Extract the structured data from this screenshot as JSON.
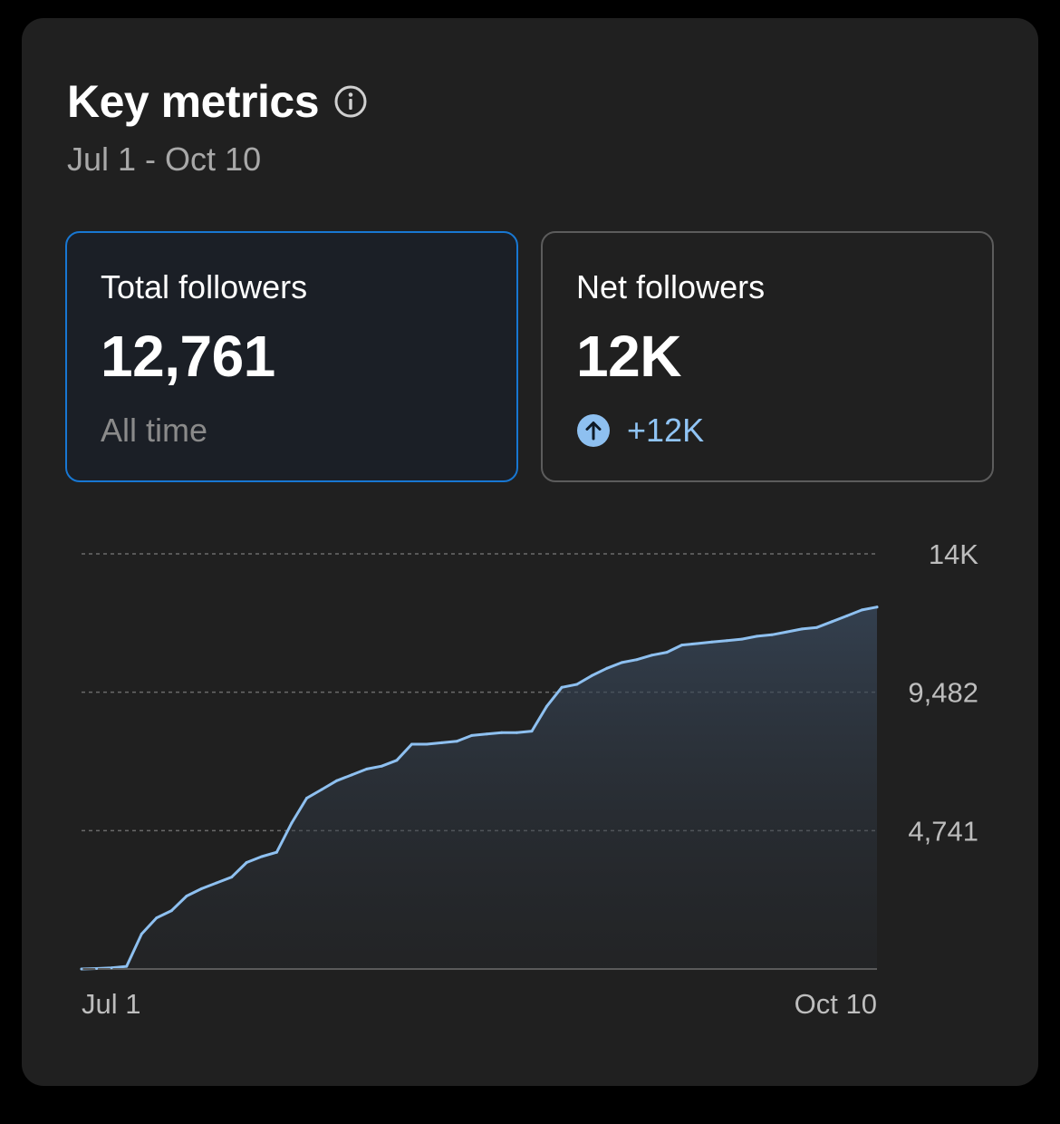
{
  "header": {
    "title": "Key metrics",
    "date_range": "Jul 1 - Oct 10",
    "info_icon": "info-circle-icon"
  },
  "metrics": [
    {
      "label": "Total followers",
      "value": "12,761",
      "sub": "All time",
      "selected": true
    },
    {
      "label": "Net followers",
      "value": "12K",
      "change": "+12K",
      "change_icon": "arrow-up-circle-icon",
      "selected": false
    }
  ],
  "colors": {
    "background": "#000000",
    "card": "#202020",
    "accent": "#1877d2",
    "line": "#8ec0f0",
    "positive": "#90c4f5"
  },
  "chart_data": {
    "type": "area",
    "x_tick_labels": [
      "Jul 1",
      "Oct 10"
    ],
    "y_tick_labels": [
      "14K",
      "9,482",
      "4,741"
    ],
    "y_ticks": [
      14223,
      9482,
      4741
    ],
    "ylim": [
      0,
      14223
    ],
    "grid": "horizontal dashed",
    "axis_position": "right",
    "x": [
      "Jul 1",
      "Jul 7",
      "Jul 13",
      "Jul 17",
      "Jul 19",
      "Jul 21",
      "Jul 23",
      "Jul 25",
      "Jul 27",
      "Jul 29",
      "Aug 1",
      "Aug 2",
      "Aug 4",
      "Aug 5",
      "Aug 7",
      "Aug 8",
      "Aug 9",
      "Aug 11",
      "Aug 12",
      "Aug 13",
      "Aug 16",
      "Aug 17",
      "Aug 18",
      "Aug 20",
      "Aug 21",
      "Aug 22",
      "Aug 24",
      "Aug 25",
      "Aug 27",
      "Aug 28",
      "Aug 30",
      "Sep 3",
      "Sep 7",
      "Sep 8",
      "Sep 10",
      "Sep 12",
      "Sep 13",
      "Sep 14",
      "Sep 15",
      "Sep 16",
      "Sep 18",
      "Sep 19",
      "Sep 21",
      "Sep 23",
      "Sep 26",
      "Sep 27",
      "Sep 29",
      "Oct 1",
      "Oct 3",
      "Oct 5",
      "Oct 7",
      "Oct 8",
      "Oct 9",
      "Oct 10"
    ],
    "values": [
      0,
      15,
      40,
      90,
      1200,
      1750,
      2000,
      2500,
      2750,
      2950,
      3150,
      3650,
      3850,
      4000,
      5000,
      5850,
      6150,
      6450,
      6650,
      6850,
      6950,
      7150,
      7700,
      7700,
      7750,
      7800,
      8000,
      8050,
      8100,
      8100,
      8150,
      9000,
      9650,
      9750,
      10050,
      10300,
      10500,
      10600,
      10750,
      10850,
      11100,
      11150,
      11200,
      11250,
      11300,
      11400,
      11450,
      11550,
      11650,
      11700,
      11900,
      12100,
      12300,
      12400
    ]
  }
}
